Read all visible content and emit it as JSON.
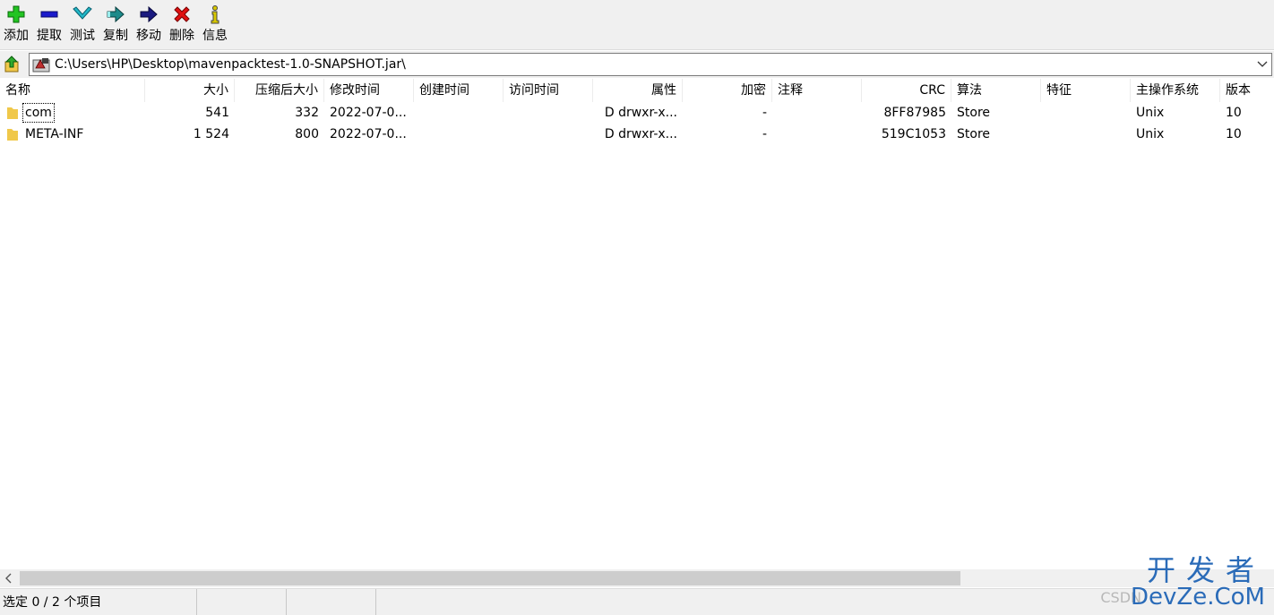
{
  "toolbar": {
    "add": "添加",
    "extract": "提取",
    "test": "测试",
    "copy": "复制",
    "move": "移动",
    "delete": "删除",
    "info": "信息"
  },
  "address": {
    "path": "C:\\Users\\HP\\Desktop\\mavenpacktest-1.0-SNAPSHOT.jar\\"
  },
  "columns": {
    "name": "名称",
    "size": "大小",
    "packed": "压缩后大小",
    "modified": "修改时间",
    "created": "创建时间",
    "accessed": "访问时间",
    "attributes": "属性",
    "encrypted": "加密",
    "comment": "注释",
    "crc": "CRC",
    "method": "算法",
    "characteristics": "特征",
    "host_os": "主操作系统",
    "version": "版本"
  },
  "rows": [
    {
      "name": "com",
      "size": "541",
      "packed": "332",
      "modified": "2022-07-0...",
      "created": "",
      "accessed": "",
      "attributes": "D drwxr-x...",
      "encrypted": "-",
      "comment": "",
      "crc": "8FF87985",
      "method": "Store",
      "characteristics": "",
      "host_os": "Unix",
      "version": "10"
    },
    {
      "name": "META-INF",
      "size": "1 524",
      "packed": "800",
      "modified": "2022-07-0...",
      "created": "",
      "accessed": "",
      "attributes": "D drwxr-x...",
      "encrypted": "-",
      "comment": "",
      "crc": "519C1053",
      "method": "Store",
      "characteristics": "",
      "host_os": "Unix",
      "version": "10"
    }
  ],
  "status": {
    "selection": "选定 0 / 2 个项目"
  },
  "watermark": {
    "line1": "开发者",
    "line2": "DevZe.CoM",
    "csdn": "CSDN"
  },
  "icons": {
    "add": "plus-icon",
    "extract": "minus-icon",
    "test": "check-icon",
    "copy": "copy-arrow-icon",
    "move": "move-arrow-icon",
    "delete": "x-icon",
    "info": "info-icon"
  },
  "colors": {
    "add": "#22c422",
    "extract": "#1a1acc",
    "test": "#22b8c8",
    "copy": "#1e7a7a",
    "move": "#1a1a80",
    "delete": "#e01010",
    "info": "#d8c800",
    "folder": "#f0c84a"
  }
}
